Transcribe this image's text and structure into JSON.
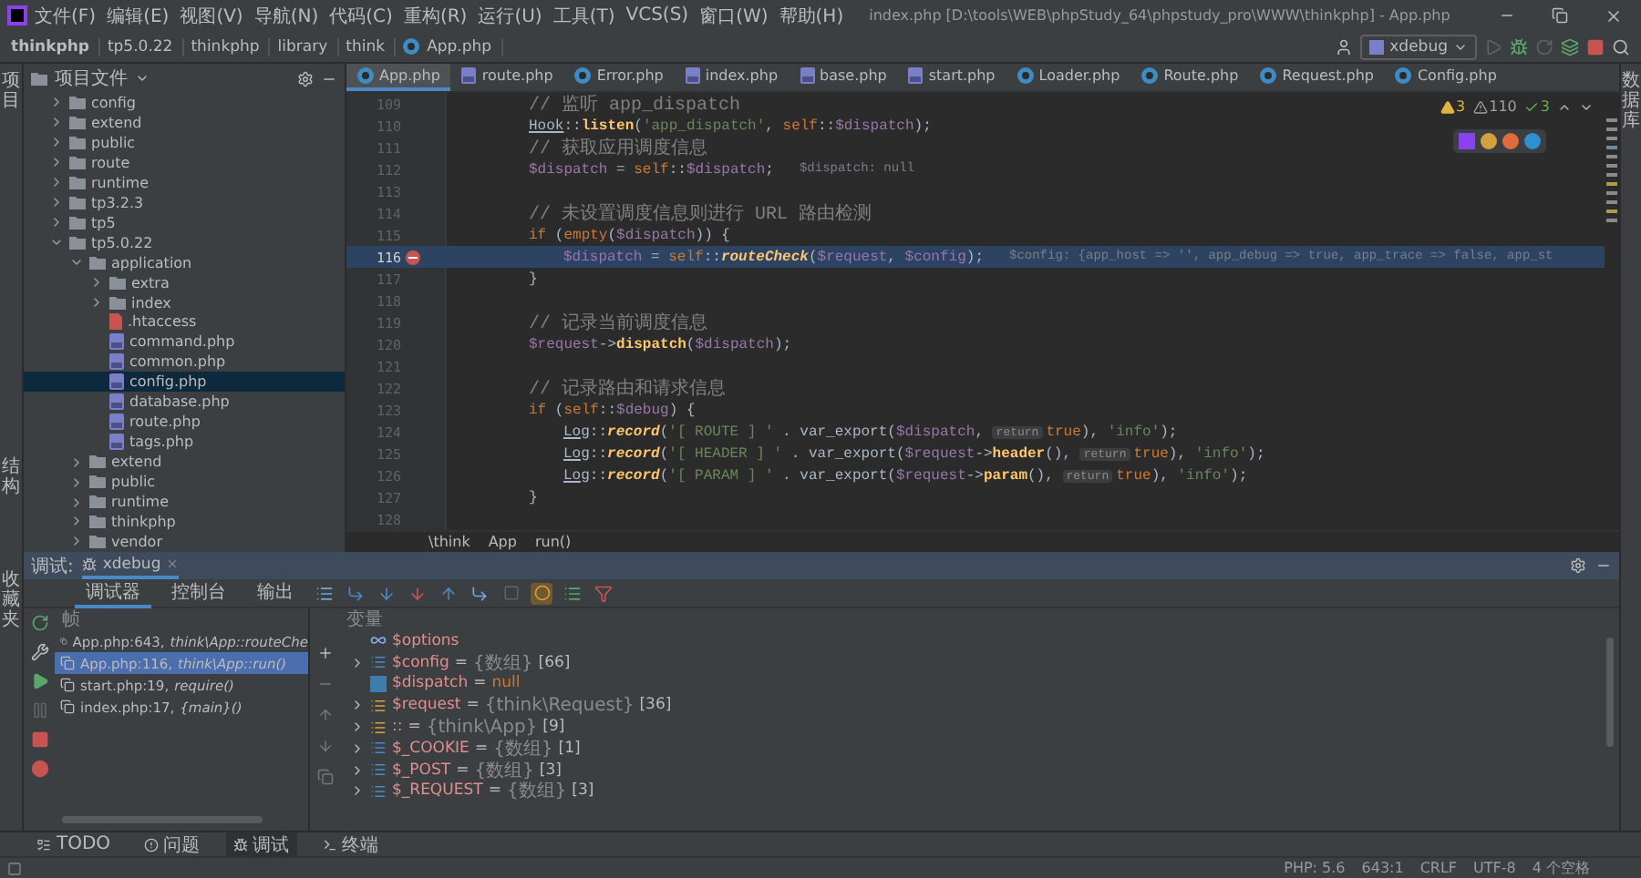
{
  "menu": [
    "文件(F)",
    "编辑(E)",
    "视图(V)",
    "导航(N)",
    "代码(C)",
    "重构(R)",
    "运行(U)",
    "工具(T)",
    "VCS(S)",
    "窗口(W)",
    "帮助(H)"
  ],
  "window_title": "index.php [D:\\tools\\WEB\\phpStudy_64\\phpstudy_pro\\WWW\\thinkphp] - App.php",
  "breadcrumb": [
    "thinkphp",
    "tp5.0.22",
    "thinkphp",
    "library",
    "think",
    "App.php"
  ],
  "run_config": "xdebug",
  "left_strip": {
    "top": "项目",
    "bottom": [
      "结构",
      "收藏夹"
    ]
  },
  "right_strip": "数据库",
  "project": {
    "title": "项目文件",
    "tree": [
      {
        "name": "config",
        "kind": "folder",
        "expanded": false,
        "selected": false
      },
      {
        "name": "extend",
        "kind": "folder",
        "expanded": false,
        "selected": false
      },
      {
        "name": "public",
        "kind": "folder",
        "expanded": false,
        "selected": false
      },
      {
        "name": "route",
        "kind": "folder",
        "expanded": false,
        "selected": false
      },
      {
        "name": "runtime",
        "kind": "folder",
        "expanded": false,
        "selected": false
      },
      {
        "name": "tp3.2.3",
        "kind": "folder",
        "expanded": false,
        "selected": false
      },
      {
        "name": "tp5",
        "kind": "folder",
        "expanded": false,
        "selected": false
      },
      {
        "name": "tp5.0.22",
        "kind": "folder",
        "expanded": true,
        "selected": false,
        "children": [
          {
            "name": "application",
            "kind": "folder",
            "expanded": true,
            "selected": false,
            "children": [
              {
                "name": "extra",
                "kind": "folder",
                "expanded": false,
                "selected": false
              },
              {
                "name": "index",
                "kind": "folder",
                "expanded": false,
                "selected": false
              },
              {
                "name": ".htaccess",
                "kind": "htaccess",
                "selected": false
              },
              {
                "name": "command.php",
                "kind": "php",
                "selected": false
              },
              {
                "name": "common.php",
                "kind": "php",
                "selected": false
              },
              {
                "name": "config.php",
                "kind": "php",
                "selected": true
              },
              {
                "name": "database.php",
                "kind": "php",
                "selected": false
              },
              {
                "name": "route.php",
                "kind": "php",
                "selected": false
              },
              {
                "name": "tags.php",
                "kind": "php",
                "selected": false
              }
            ]
          },
          {
            "name": "extend",
            "kind": "folder",
            "expanded": false,
            "selected": false
          },
          {
            "name": "public",
            "kind": "folder",
            "expanded": false,
            "selected": false
          },
          {
            "name": "runtime",
            "kind": "folder",
            "expanded": false,
            "selected": false
          },
          {
            "name": "thinkphp",
            "kind": "folder",
            "expanded": false,
            "selected": false
          },
          {
            "name": "vendor",
            "kind": "folder",
            "expanded": false,
            "selected": false
          }
        ]
      }
    ]
  },
  "tabs": [
    {
      "label": "App.php",
      "kind": "class",
      "selected": true
    },
    {
      "label": "route.php",
      "kind": "php",
      "selected": false
    },
    {
      "label": "Error.php",
      "kind": "class",
      "selected": false
    },
    {
      "label": "index.php",
      "kind": "php",
      "selected": false
    },
    {
      "label": "base.php",
      "kind": "php",
      "selected": false
    },
    {
      "label": "start.php",
      "kind": "php",
      "selected": false
    },
    {
      "label": "Loader.php",
      "kind": "class",
      "selected": false
    },
    {
      "label": "Route.php",
      "kind": "class",
      "selected": false
    },
    {
      "label": "Request.php",
      "kind": "class",
      "selected": false
    },
    {
      "label": "Config.php",
      "kind": "class",
      "selected": false
    }
  ],
  "inspections": [
    {
      "kind": "warning",
      "count": "3"
    },
    {
      "kind": "weak",
      "count": "110"
    },
    {
      "kind": "ok",
      "count": "3"
    }
  ],
  "code": {
    "lines": [
      {
        "number": "109",
        "current": false,
        "breakpoint": false,
        "nested": false,
        "tokens": [
          {
            "text": "// 监听 app_dispatch",
            "kind": "comment"
          }
        ]
      },
      {
        "number": "110",
        "current": false,
        "breakpoint": false,
        "nested": false,
        "tokens": [
          {
            "text": "Hook",
            "kind": "class"
          },
          {
            "text": "::",
            "kind": "plain"
          },
          {
            "text": "listen",
            "kind": "func"
          },
          {
            "text": "(",
            "kind": "plain"
          },
          {
            "text": "'app_dispatch'",
            "kind": "string"
          },
          {
            "text": ", ",
            "kind": "plain"
          },
          {
            "text": "self",
            "kind": "keyword"
          },
          {
            "text": "::",
            "kind": "plain"
          },
          {
            "text": "$dispatch",
            "kind": "var"
          },
          {
            "text": ");",
            "kind": "plain"
          }
        ]
      },
      {
        "number": "111",
        "current": false,
        "breakpoint": false,
        "nested": false,
        "tokens": [
          {
            "text": "// 获取应用调度信息",
            "kind": "comment"
          }
        ]
      },
      {
        "number": "112",
        "current": false,
        "breakpoint": false,
        "nested": false,
        "tokens": [
          {
            "text": "$dispatch",
            "kind": "var"
          },
          {
            "text": " = ",
            "kind": "plain"
          },
          {
            "text": "self",
            "kind": "keyword"
          },
          {
            "text": "::",
            "kind": "plain"
          },
          {
            "text": "$dispatch",
            "kind": "var"
          },
          {
            "text": ";",
            "kind": "plain"
          },
          {
            "text": "$dispatch: null",
            "kind": "hint"
          }
        ]
      },
      {
        "number": "113",
        "current": false,
        "breakpoint": false,
        "nested": false
      },
      {
        "number": "114",
        "current": false,
        "breakpoint": false,
        "nested": false,
        "tokens": [
          {
            "text": "// 未设置调度信息则进行 URL 路由检测",
            "kind": "comment"
          }
        ]
      },
      {
        "number": "115",
        "current": false,
        "breakpoint": false,
        "nested": false,
        "tokens": [
          {
            "text": "if",
            "kind": "keyword"
          },
          {
            "text": " (",
            "kind": "plain"
          },
          {
            "text": "empty",
            "kind": "keyword"
          },
          {
            "text": "(",
            "kind": "plain"
          },
          {
            "text": "$dispatch",
            "kind": "var"
          },
          {
            "text": ")) {",
            "kind": "plain"
          }
        ]
      },
      {
        "number": "116",
        "current": true,
        "breakpoint": true,
        "nested": true,
        "tokens": [
          {
            "text": "$dispatch",
            "kind": "var"
          },
          {
            "text": " = ",
            "kind": "plain"
          },
          {
            "text": "self",
            "kind": "keyword"
          },
          {
            "text": "::",
            "kind": "plain"
          },
          {
            "text": "routeCheck",
            "kind": "static"
          },
          {
            "text": "(",
            "kind": "plain"
          },
          {
            "text": "$request",
            "kind": "var"
          },
          {
            "text": ", ",
            "kind": "plain"
          },
          {
            "text": "$config",
            "kind": "var"
          },
          {
            "text": ");",
            "kind": "plain"
          },
          {
            "text": "$config: {app_host => '', app_debug => true, app_trace => false, app_st",
            "kind": "hint"
          }
        ]
      },
      {
        "number": "117",
        "current": false,
        "breakpoint": false,
        "nested": false,
        "tokens": [
          {
            "text": "}",
            "kind": "plain"
          }
        ]
      },
      {
        "number": "118",
        "current": false,
        "breakpoint": false,
        "nested": false
      },
      {
        "number": "119",
        "current": false,
        "breakpoint": false,
        "nested": false,
        "tokens": [
          {
            "text": "// 记录当前调度信息",
            "kind": "comment"
          }
        ]
      },
      {
        "number": "120",
        "current": false,
        "breakpoint": false,
        "nested": false,
        "tokens": [
          {
            "text": "$request",
            "kind": "var"
          },
          {
            "text": "->",
            "kind": "plain"
          },
          {
            "text": "dispatch",
            "kind": "func"
          },
          {
            "text": "(",
            "kind": "plain"
          },
          {
            "text": "$dispatch",
            "kind": "var"
          },
          {
            "text": ");",
            "kind": "plain"
          }
        ]
      },
      {
        "number": "121",
        "current": false,
        "breakpoint": false,
        "nested": false
      },
      {
        "number": "122",
        "current": false,
        "breakpoint": false,
        "nested": false,
        "tokens": [
          {
            "text": "// 记录路由和请求信息",
            "kind": "comment"
          }
        ]
      },
      {
        "number": "123",
        "current": false,
        "breakpoint": false,
        "nested": false,
        "tokens": [
          {
            "text": "if",
            "kind": "keyword"
          },
          {
            "text": " (",
            "kind": "plain"
          },
          {
            "text": "self",
            "kind": "keyword"
          },
          {
            "text": "::",
            "kind": "plain"
          },
          {
            "text": "$debug",
            "kind": "var"
          },
          {
            "text": ") {",
            "kind": "plain"
          }
        ]
      },
      {
        "number": "124",
        "current": false,
        "breakpoint": false,
        "nested": true,
        "tokens": [
          {
            "text": "Log",
            "kind": "class"
          },
          {
            "text": "::",
            "kind": "plain"
          },
          {
            "text": "record",
            "kind": "static"
          },
          {
            "text": "(",
            "kind": "plain"
          },
          {
            "text": "'[ ROUTE ] '",
            "kind": "string"
          },
          {
            "text": " . var_export(",
            "kind": "plain"
          },
          {
            "text": "$dispatch",
            "kind": "var"
          },
          {
            "text": ", ",
            "kind": "plain"
          },
          {
            "text": "return",
            "kind": "param"
          },
          {
            "text": "true",
            "kind": "keyword"
          },
          {
            "text": "), ",
            "kind": "plain"
          },
          {
            "text": "'info'",
            "kind": "string"
          },
          {
            "text": ");",
            "kind": "plain"
          }
        ]
      },
      {
        "number": "125",
        "current": false,
        "breakpoint": false,
        "nested": true,
        "tokens": [
          {
            "text": "Log",
            "kind": "class"
          },
          {
            "text": "::",
            "kind": "plain"
          },
          {
            "text": "record",
            "kind": "static"
          },
          {
            "text": "(",
            "kind": "plain"
          },
          {
            "text": "'[ HEADER ] '",
            "kind": "string"
          },
          {
            "text": " . var_export(",
            "kind": "plain"
          },
          {
            "text": "$request",
            "kind": "var"
          },
          {
            "text": "->",
            "kind": "plain"
          },
          {
            "text": "header",
            "kind": "func"
          },
          {
            "text": "(), ",
            "kind": "plain"
          },
          {
            "text": "return",
            "kind": "param"
          },
          {
            "text": "true",
            "kind": "keyword"
          },
          {
            "text": "), ",
            "kind": "plain"
          },
          {
            "text": "'info'",
            "kind": "string"
          },
          {
            "text": ");",
            "kind": "plain"
          }
        ]
      },
      {
        "number": "126",
        "current": false,
        "breakpoint": false,
        "nested": true,
        "tokens": [
          {
            "text": "Log",
            "kind": "class"
          },
          {
            "text": "::",
            "kind": "plain"
          },
          {
            "text": "record",
            "kind": "static"
          },
          {
            "text": "(",
            "kind": "plain"
          },
          {
            "text": "'[ PARAM ] '",
            "kind": "string"
          },
          {
            "text": " . var_export(",
            "kind": "plain"
          },
          {
            "text": "$request",
            "kind": "var"
          },
          {
            "text": "->",
            "kind": "plain"
          },
          {
            "text": "param",
            "kind": "func"
          },
          {
            "text": "(), ",
            "kind": "plain"
          },
          {
            "text": "return",
            "kind": "param"
          },
          {
            "text": "true",
            "kind": "keyword"
          },
          {
            "text": "), ",
            "kind": "plain"
          },
          {
            "text": "'info'",
            "kind": "string"
          },
          {
            "text": ");",
            "kind": "plain"
          }
        ]
      },
      {
        "number": "127",
        "current": false,
        "breakpoint": false,
        "nested": false,
        "tokens": [
          {
            "text": "}",
            "kind": "plain"
          }
        ]
      },
      {
        "number": "128",
        "current": false,
        "breakpoint": false,
        "nested": false
      }
    ]
  },
  "editor_breadcrumb": [
    "\\think",
    "App",
    "run()"
  ],
  "debug": {
    "label": "调试:",
    "session": "xdebug",
    "subtabs": [
      {
        "label": "调试器",
        "selected": true
      },
      {
        "label": "控制台",
        "selected": false
      },
      {
        "label": "输出",
        "selected": false
      }
    ],
    "frames_header": "帧",
    "frames": [
      {
        "file": "App.php:643,",
        "method": "think\\App::routeChe",
        "selected": false
      },
      {
        "file": "App.php:116,",
        "method": "think\\App::run()",
        "selected": true
      },
      {
        "file": "start.php:19,",
        "method": "require()",
        "selected": false
      },
      {
        "file": "index.php:17,",
        "method": "{main}()",
        "selected": false
      }
    ],
    "variables_header": "变量",
    "variables": [
      {
        "name": "$options",
        "kind": "watch",
        "expandable": false
      },
      {
        "name": "$config",
        "assign": "=",
        "kind": "array",
        "type": "{数组}",
        "count": "[66]",
        "expandable": true
      },
      {
        "name": "$dispatch",
        "assign": "=",
        "kind": "scalar",
        "value": "null",
        "expandable": false
      },
      {
        "name": "$request",
        "assign": "=",
        "kind": "object",
        "type": "{think\\Request}",
        "count": "[36]",
        "expandable": true
      },
      {
        "name": "::",
        "assign": "=",
        "kind": "object",
        "type": "{think\\App}",
        "count": "[9]",
        "expandable": true
      },
      {
        "name": "$_COOKIE",
        "assign": "=",
        "kind": "array",
        "type": "{数组}",
        "count": "[1]",
        "expandable": true
      },
      {
        "name": "$_POST",
        "assign": "=",
        "kind": "array",
        "type": "{数组}",
        "count": "[3]",
        "expandable": true
      },
      {
        "name": "$_REQUEST",
        "assign": "=",
        "kind": "array",
        "type": "{数组}",
        "count": "[3]",
        "expandable": true
      }
    ]
  },
  "bottom_tabs": [
    {
      "label": "TODO",
      "selected": false
    },
    {
      "label": "问题",
      "selected": false
    },
    {
      "label": "调试",
      "selected": true
    },
    {
      "label": "终端",
      "selected": false
    }
  ],
  "status": [
    "PHP: 5.6",
    "643:1",
    "CRLF",
    "UTF-8",
    "4 个空格"
  ]
}
